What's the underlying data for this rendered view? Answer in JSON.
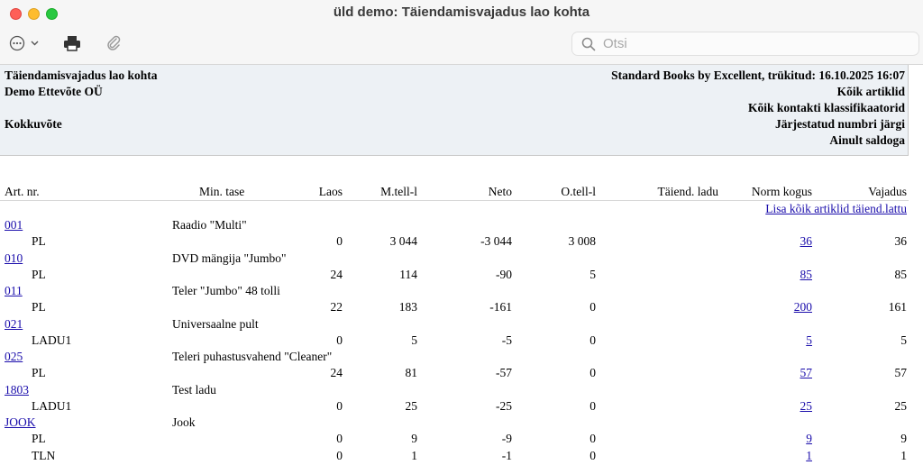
{
  "window": {
    "title": "üld demo: Täiendamisvajadus lao kohta"
  },
  "toolbar": {
    "search_placeholder": "Otsi"
  },
  "report": {
    "left": [
      "Täiendamisvajadus lao kohta",
      "Demo Ettevõte OÜ",
      "Kokkuvõte"
    ],
    "right": [
      "Standard Books by Excellent, trükitud: 16.10.2025 16:07",
      "Kõik artiklid",
      "Kõik kontakti klassifikaatorid",
      "Järjestatud numbri järgi",
      "Ainult saldoga"
    ]
  },
  "columns": {
    "art_nr": "Art. nr.",
    "min_tase": "Min. tase",
    "laos": "Laos",
    "mtell": "M.tell-l",
    "neto": "Neto",
    "otell": "O.tell-l",
    "taiend": "Täiend. ladu",
    "norm": "Norm kogus",
    "vajadus": "Vajadus"
  },
  "add_all_link": "Lisa kõik artiklid täiend.lattu",
  "articles": [
    {
      "code": "001",
      "name": "Raadio \"Multi\"",
      "rows": [
        {
          "wh": "PL",
          "laos": "0",
          "mtell": "3 044",
          "neto": "-3 044",
          "otell": "3 008",
          "norm": "36",
          "vajadus": "36"
        }
      ]
    },
    {
      "code": "010",
      "name": "DVD mängija \"Jumbo\"",
      "rows": [
        {
          "wh": "PL",
          "laos": "24",
          "mtell": "114",
          "neto": "-90",
          "otell": "5",
          "norm": "85",
          "vajadus": "85"
        }
      ]
    },
    {
      "code": "011",
      "name": "Teler \"Jumbo\" 48 tolli",
      "rows": [
        {
          "wh": "PL",
          "laos": "22",
          "mtell": "183",
          "neto": "-161",
          "otell": "0",
          "norm": "200",
          "vajadus": "161"
        }
      ]
    },
    {
      "code": "021",
      "name": "Universaalne pult",
      "rows": [
        {
          "wh": "LADU1",
          "laos": "0",
          "mtell": "5",
          "neto": "-5",
          "otell": "0",
          "norm": "5",
          "vajadus": "5"
        }
      ]
    },
    {
      "code": "025",
      "name": "Teleri puhastusvahend \"Cleaner\"",
      "rows": [
        {
          "wh": "PL",
          "laos": "24",
          "mtell": "81",
          "neto": "-57",
          "otell": "0",
          "norm": "57",
          "vajadus": "57"
        }
      ]
    },
    {
      "code": "1803",
      "name": "Test ladu",
      "rows": [
        {
          "wh": "LADU1",
          "laos": "0",
          "mtell": "25",
          "neto": "-25",
          "otell": "0",
          "norm": "25",
          "vajadus": "25"
        }
      ]
    },
    {
      "code": "JOOK",
      "name": "Jook",
      "rows": [
        {
          "wh": "PL",
          "laos": "0",
          "mtell": "9",
          "neto": "-9",
          "otell": "0",
          "norm": "9",
          "vajadus": "9"
        },
        {
          "wh": "TLN",
          "laos": "0",
          "mtell": "1",
          "neto": "-1",
          "otell": "0",
          "norm": "1",
          "vajadus": "1"
        }
      ]
    }
  ]
}
